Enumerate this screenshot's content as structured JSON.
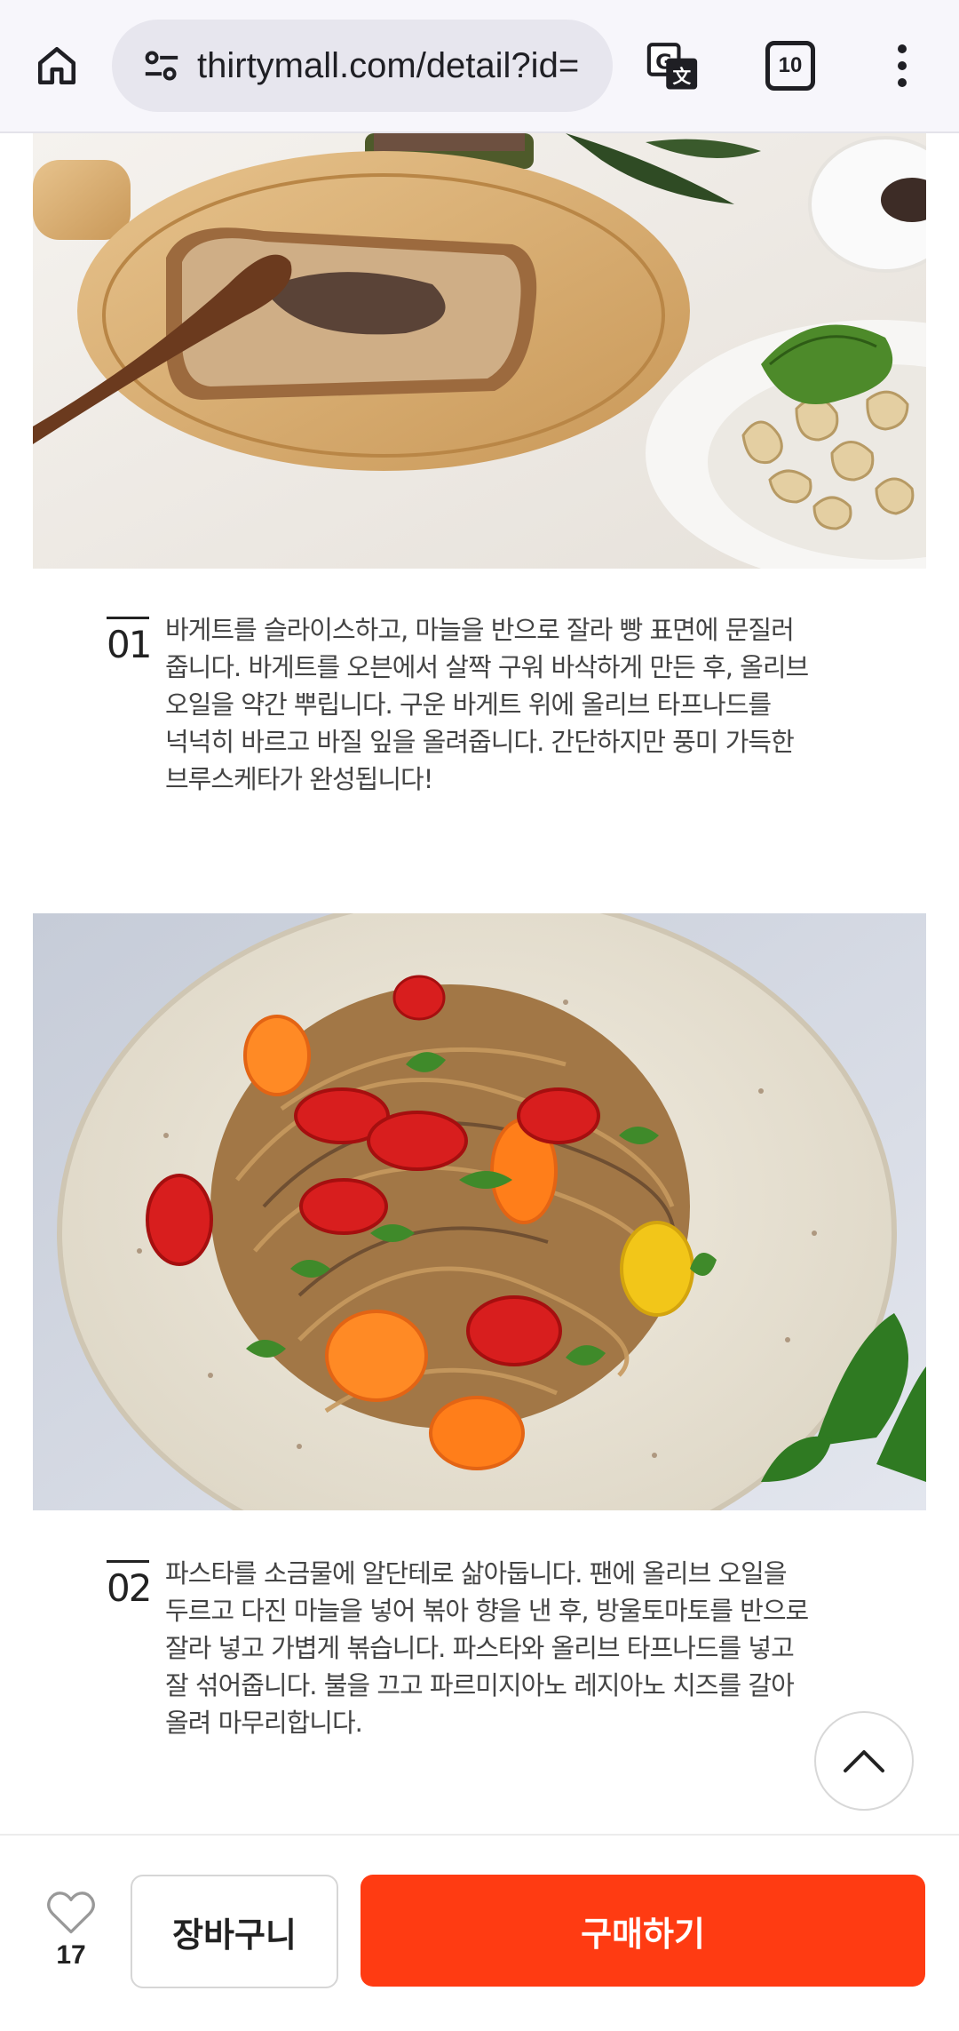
{
  "browser": {
    "url": "thirtymall.com/detail?id=",
    "tab_count": "10",
    "icons": [
      "home-icon",
      "site-settings-icon",
      "translate-icon",
      "tabs-icon",
      "more-vert-icon"
    ]
  },
  "content": {
    "photo1": {
      "alt": "bread-with-olive-tapenade-photo"
    },
    "step1": {
      "number": "01",
      "text": "바게트를 슬라이스하고, 마늘을 반으로 잘라 빵 표면에 문질러\n줍니다.  바게트를 오븐에서 살짝 구워 바삭하게 만든 후, 올리브\n오일을 약간 뿌립니다.  구운 바게트 위에 올리브 타프나드를\n넉넉히 바르고 바질 잎을 올려줍니다.  간단하지만 풍미 가득한\n브루스케타가 완성됩니다!"
    },
    "photo2": {
      "alt": "pasta-with-olive-tapenade-photo"
    },
    "step2": {
      "number": "02",
      "text": "파스타를 소금물에 알단테로 삶아둡니다.  팬에 올리브 오일을\n두르고 다진 마늘을 넣어 볶아 향을 낸 후, 방울토마토를 반으로\n잘라 넣고 가볍게 볶습니다.  파스타와 올리브 타프나드를 넣고\n잘 섞어줍니다.  불을 끄고 파르미지아노 레지아노 치즈를 갈아\n올려 마무리합니다."
    }
  },
  "bottom_bar": {
    "like_count": "17",
    "cart_label": "장바구니",
    "buy_label": "구매하기",
    "buy_color": "#ff3b12"
  }
}
